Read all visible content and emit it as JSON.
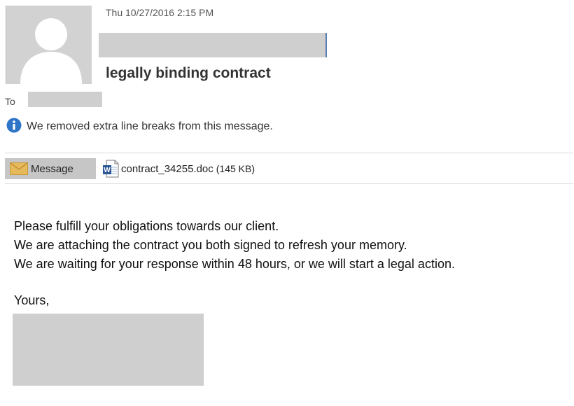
{
  "header": {
    "date": "Thu 10/27/2016 2:15 PM",
    "subject": "legally binding contract",
    "to_label": "To"
  },
  "info_bar": {
    "icon": "info-icon",
    "text": "We removed extra line breaks from this message."
  },
  "tabs": {
    "message_label": "Message",
    "message_icon": "envelope-icon"
  },
  "attachment": {
    "icon": "word-doc-icon",
    "name": "contract_34255.doc",
    "size": "(145 KB)"
  },
  "body": {
    "lines": [
      "Please fulfill your obligations towards our client.",
      "We are attaching the contract you both signed to refresh your memory.",
      "We are waiting for your response within 48 hours, or we will start a legal action."
    ],
    "closing": "Yours,"
  },
  "colors": {
    "redaction": "#cfcfcf",
    "info_blue": "#2e75c7",
    "tab_bg": "#c6c6c6",
    "envelope": "#e6b95a"
  }
}
